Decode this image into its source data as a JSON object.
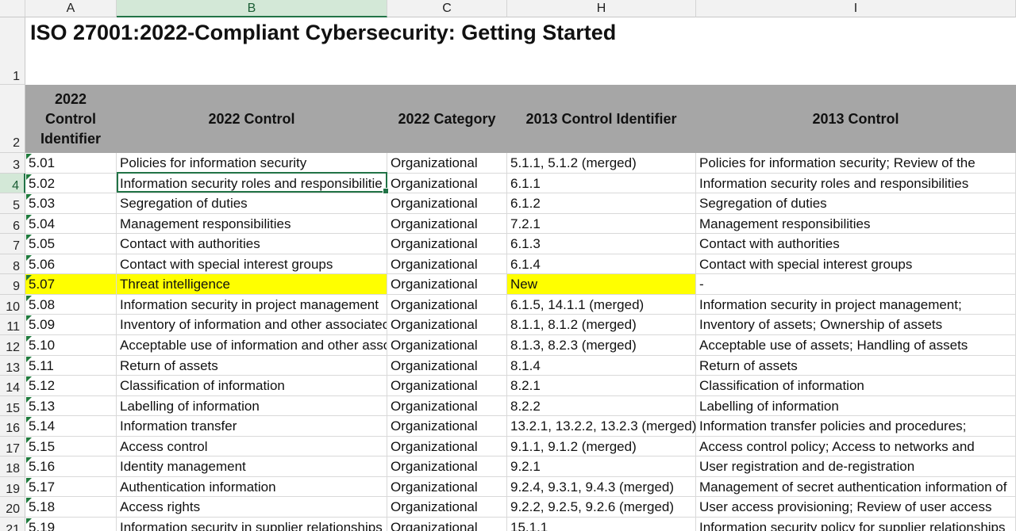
{
  "column_headers": [
    "A",
    "B",
    "C",
    "H",
    "I"
  ],
  "active_column": "B",
  "active_row": "4",
  "title": "ISO 27001:2022-Compliant Cybersecurity: Getting Started",
  "table_headers": [
    "2022 Control Identifier",
    "2022 Control",
    "2022 Category",
    "2013 Control Identifier",
    "2013 Control"
  ],
  "row_numbers": [
    "1",
    "2",
    "3",
    "4",
    "5",
    "6",
    "7",
    "8",
    "9",
    "10",
    "11",
    "12",
    "13",
    "14",
    "15",
    "16",
    "17",
    "18",
    "19",
    "20",
    "21"
  ],
  "highlight_color": "#ffff00",
  "header_fill_color": "#a6a6a6",
  "rows": [
    {
      "id": "5.01",
      "control": "Policies for information security",
      "category": "Organizational",
      "id2013": "5.1.1, 5.1.2 (merged)",
      "control2013": "Policies for information security; Review of the"
    },
    {
      "id": "5.02",
      "control": "Information security roles and responsibilitie",
      "category": "Organizational",
      "id2013": "6.1.1",
      "control2013": "Information security roles and responsibilities"
    },
    {
      "id": "5.03",
      "control": "Segregation of duties",
      "category": "Organizational",
      "id2013": "6.1.2",
      "control2013": "Segregation of duties"
    },
    {
      "id": "5.04",
      "control": "Management responsibilities",
      "category": "Organizational",
      "id2013": "7.2.1",
      "control2013": "Management responsibilities"
    },
    {
      "id": "5.05",
      "control": "Contact with authorities",
      "category": "Organizational",
      "id2013": "6.1.3",
      "control2013": "Contact with authorities"
    },
    {
      "id": "5.06",
      "control": "Contact with special interest groups",
      "category": "Organizational",
      "id2013": "6.1.4",
      "control2013": "Contact with special interest groups"
    },
    {
      "id": "5.07",
      "control": "Threat intelligence",
      "category": "Organizational",
      "id2013": "New",
      "control2013": "-",
      "highlight": true
    },
    {
      "id": "5.08",
      "control": "Information security in project management",
      "category": "Organizational",
      "id2013": "6.1.5, 14.1.1 (merged)",
      "control2013": "Information security in project management;"
    },
    {
      "id": "5.09",
      "control": "Inventory of information and other associatec",
      "category": "Organizational",
      "id2013": "8.1.1, 8.1.2 (merged)",
      "control2013": "Inventory of assets; Ownership of assets"
    },
    {
      "id": "5.10",
      "control": "Acceptable use of information and other asso",
      "category": "Organizational",
      "id2013": "8.1.3, 8.2.3 (merged)",
      "control2013": "Acceptable use of assets; Handling of assets"
    },
    {
      "id": "5.11",
      "control": "Return of assets",
      "category": "Organizational",
      "id2013": "8.1.4",
      "control2013": "Return of assets"
    },
    {
      "id": "5.12",
      "control": "Classification of information",
      "category": "Organizational",
      "id2013": "8.2.1",
      "control2013": "Classification of information"
    },
    {
      "id": "5.13",
      "control": "Labelling of information",
      "category": "Organizational",
      "id2013": "8.2.2",
      "control2013": "Labelling of information"
    },
    {
      "id": "5.14",
      "control": "Information transfer",
      "category": "Organizational",
      "id2013": "13.2.1, 13.2.2, 13.2.3 (merged)",
      "control2013": "Information transfer policies and procedures;"
    },
    {
      "id": "5.15",
      "control": "Access control",
      "category": "Organizational",
      "id2013": "9.1.1, 9.1.2 (merged)",
      "control2013": "Access control policy; Access to networks and"
    },
    {
      "id": "5.16",
      "control": "Identity management",
      "category": "Organizational",
      "id2013": "9.2.1",
      "control2013": "User registration and de-registration"
    },
    {
      "id": "5.17",
      "control": "Authentication information",
      "category": "Organizational",
      "id2013": "9.2.4, 9.3.1, 9.4.3 (merged)",
      "control2013": "Management of secret authentication information of"
    },
    {
      "id": "5.18",
      "control": "Access rights",
      "category": "Organizational",
      "id2013": "9.2.2, 9.2.5, 9.2.6 (merged)",
      "control2013": "User access provisioning; Review of user access"
    },
    {
      "id": "5.19",
      "control": "Information security in supplier relationships",
      "category": "Organizational",
      "id2013": "15.1.1",
      "control2013": "Information security policy for supplier relationships"
    }
  ]
}
